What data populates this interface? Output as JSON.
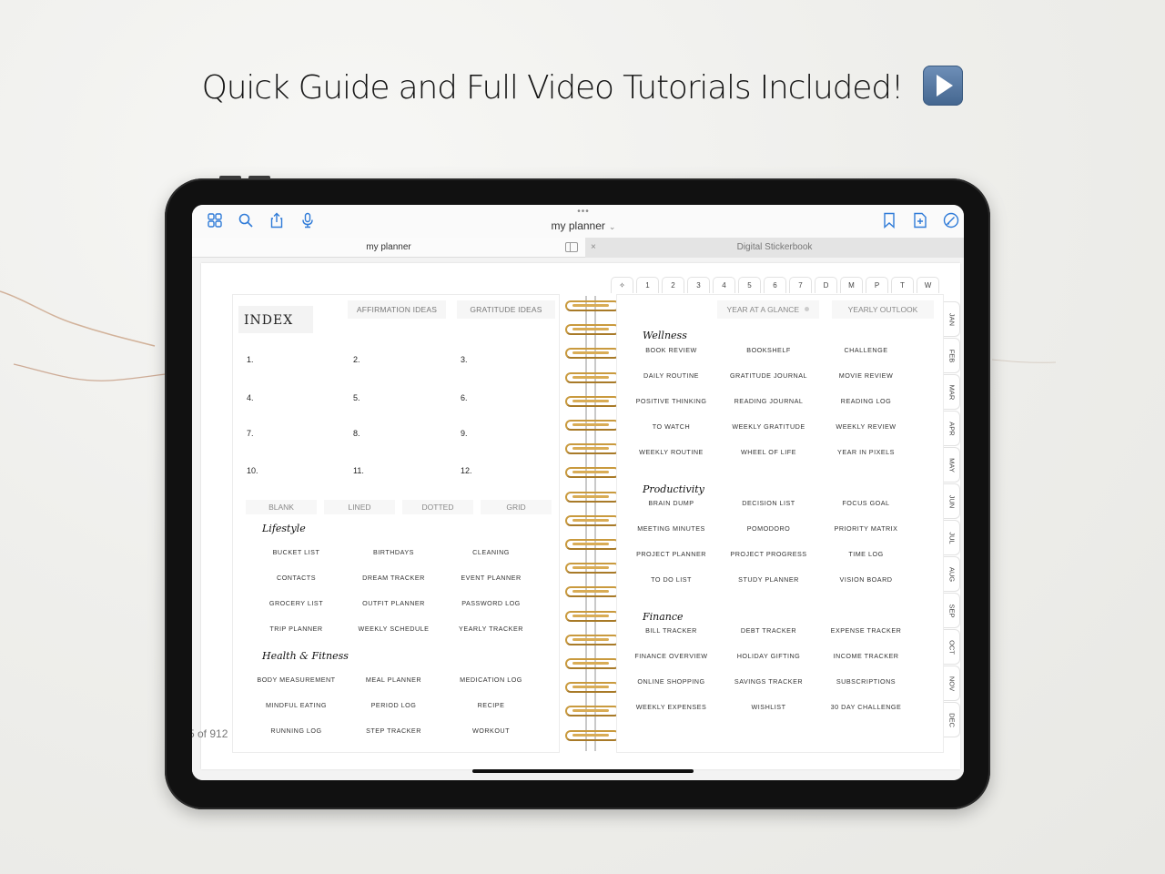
{
  "headline": {
    "text": "Quick Guide and Full Video Tutorials Included!",
    "icon": "play-button-icon"
  },
  "app": {
    "toolbar": {
      "left_icons": [
        "grid-icon",
        "search-icon",
        "share-icon",
        "microphone-icon"
      ],
      "right_icons": [
        "bookmark-icon",
        "add-page-icon",
        "pencil-circle-icon"
      ],
      "grabber": "•••",
      "document_title": "my planner",
      "title_chevron": "⌄"
    },
    "tabs": [
      {
        "label": "my planner",
        "active": true
      },
      {
        "label": "Digital Stickerbook",
        "active": false,
        "close": "×"
      }
    ],
    "page_counter": "5 of 912"
  },
  "planner": {
    "top_tabs": [
      "✧",
      "1",
      "2",
      "3",
      "4",
      "5",
      "6",
      "7",
      "D",
      "M",
      "P",
      "T",
      "W"
    ],
    "month_tabs": [
      "JAN",
      "FEB",
      "MAR",
      "APR",
      "MAY",
      "JUN",
      "JUL",
      "AUG",
      "SEP",
      "OCT",
      "NOV",
      "DEC"
    ],
    "left_page": {
      "title": "INDEX",
      "top_buttons": [
        "AFFIRMATION IDEAS",
        "GRATITUDE IDEAS"
      ],
      "index_numbers": [
        "1.",
        "2.",
        "3.",
        "4.",
        "5.",
        "6.",
        "7.",
        "8.",
        "9.",
        "10.",
        "11.",
        "12."
      ],
      "page_types": [
        "BLANK",
        "LINED",
        "DOTTED",
        "GRID"
      ],
      "categories": [
        {
          "title": "Lifestyle",
          "items": [
            "BUCKET LIST",
            "BIRTHDAYS",
            "CLEANING",
            "CONTACTS",
            "DREAM TRACKER",
            "EVENT PLANNER",
            "GROCERY LIST",
            "OUTFIT PLANNER",
            "PASSWORD LOG",
            "TRIP PLANNER",
            "WEEKLY SCHEDULE",
            "YEARLY TRACKER"
          ]
        },
        {
          "title": "Health & Fitness",
          "items": [
            "BODY MEASUREMENT",
            "MEAL PLANNER",
            "MEDICATION LOG",
            "MINDFUL EATING",
            "PERIOD LOG",
            "RECIPE",
            "RUNNING LOG",
            "STEP TRACKER",
            "WORKOUT"
          ]
        }
      ]
    },
    "right_page": {
      "top_buttons": [
        "YEAR AT A GLANCE",
        "YEARLY OUTLOOK"
      ],
      "categories": [
        {
          "title": "Wellness",
          "items": [
            "BOOK REVIEW",
            "BOOKSHELF",
            "CHALLENGE",
            "DAILY ROUTINE",
            "GRATITUDE JOURNAL",
            "MOVIE REVIEW",
            "POSITIVE THINKING",
            "READING JOURNAL",
            "READING LOG",
            "TO WATCH",
            "WEEKLY GRATITUDE",
            "WEEKLY REVIEW",
            "WEEKLY ROUTINE",
            "WHEEL OF LIFE",
            "YEAR IN PIXELS"
          ]
        },
        {
          "title": "Productivity",
          "items": [
            "BRAIN DUMP",
            "DECISION LIST",
            "FOCUS GOAL",
            "MEETING MINUTES",
            "POMODORO",
            "PRIORITY MATRIX",
            "PROJECT PLANNER",
            "PROJECT PROGRESS",
            "TIME LOG",
            "TO DO LIST",
            "STUDY PLANNER",
            "VISION BOARD"
          ]
        },
        {
          "title": "Finance",
          "items": [
            "BILL TRACKER",
            "DEBT TRACKER",
            "EXPENSE TRACKER",
            "FINANCE OVERVIEW",
            "HOLIDAY GIFTING",
            "INCOME TRACKER",
            "ONLINE SHOPPING",
            "SAVINGS TRACKER",
            "SUBSCRIPTIONS",
            "WEEKLY EXPENSES",
            "WISHLIST",
            "30 DAY CHALLENGE"
          ]
        }
      ]
    }
  },
  "colors": {
    "ios_blue": "#2f7bd8",
    "spiral_gold": "#c99a3e",
    "device_black": "#111111"
  }
}
